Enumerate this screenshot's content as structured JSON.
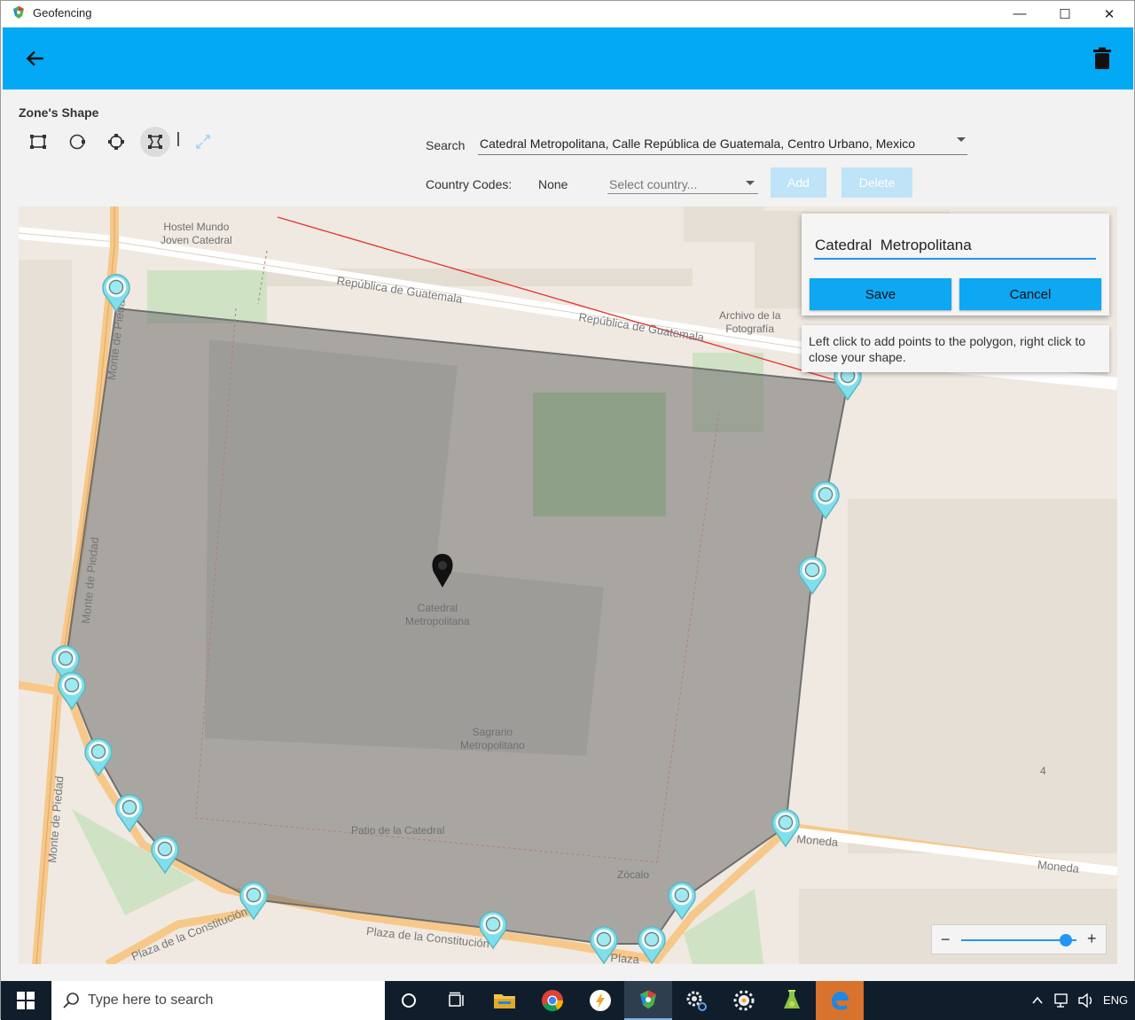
{
  "window": {
    "title": "Geofencing",
    "controls": {
      "minimize": "—",
      "maximize": "☐",
      "close": "✕"
    }
  },
  "appbar": {
    "color": "#03a9f4",
    "back_icon": "arrow-left-icon",
    "delete_icon": "trash-icon"
  },
  "toolbar": {
    "zone_shape_label": "Zone's Shape",
    "tools": [
      {
        "name": "rectangle-shape-icon",
        "active": false
      },
      {
        "name": "circle-shape-icon",
        "active": false
      },
      {
        "name": "route-shape-icon",
        "active": false
      },
      {
        "name": "polygon-shape-icon",
        "active": true
      }
    ],
    "fullscreen_icon": "expand-icon"
  },
  "search": {
    "label": "Search",
    "value": "Catedral Metropolitana, Calle República de Guatemala, Centro Urbano, Mexico"
  },
  "country_codes": {
    "label": "Country Codes:",
    "value": "None",
    "select_placeholder": "Select country...",
    "add_label": "Add",
    "delete_label": "Delete"
  },
  "map": {
    "labels": {
      "hostel": "Hostel Mundo\nJoven Catedral",
      "archivo": "Archivo de la\nFotografía",
      "catedral": "Catedral\nMetropolitana",
      "sagrario": "Sagrario\nMetropolitano",
      "patio": "Patio de la  Catedral",
      "zocalo": "Zócalo",
      "number": "4",
      "street_guatemala_1": "República de Guatemala",
      "street_guatemala_2": "República de Guatemala",
      "street_monte_1": "Monte de Piedad",
      "street_monte_2": "Monte de Piedad",
      "street_moneda_1": "Moneda",
      "street_moneda_2": "Moneda",
      "street_plaza_1": "Plaza de la Constitución",
      "street_plaza_2": "Plaza de la Constitución",
      "street_plaza_3": "Plaza"
    },
    "zone_color": "#6f6f6f",
    "vertex_color": "#7fdfea"
  },
  "popup": {
    "name_value": "Catedral  Metropolitana",
    "save_label": "Save",
    "cancel_label": "Cancel",
    "hint": "Left click to add points to the polygon, right click to close your shape."
  },
  "zoom": {
    "minus": "−",
    "plus": "+",
    "level": 0.87
  },
  "taskbar": {
    "search_placeholder": "Type here to search",
    "apps": [
      "cortana-icon",
      "task-view-icon",
      "file-explorer-icon",
      "chrome-icon",
      "lightning-app-icon",
      "geofencing-app-icon",
      "settings-icon",
      "sun-app-icon",
      "flask-app-icon",
      "edge-icon"
    ],
    "tray_language": "ENG"
  }
}
